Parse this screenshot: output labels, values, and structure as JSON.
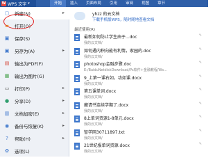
{
  "app": {
    "title": "WPS 文字",
    "logo": "W",
    "caret": "▾"
  },
  "tabs": [
    {
      "label": "开始",
      "active": true
    },
    {
      "label": "插入"
    },
    {
      "label": "页面布局"
    },
    {
      "label": "引用"
    },
    {
      "label": "审阅"
    },
    {
      "label": "视图"
    },
    {
      "label": "章节"
    }
  ],
  "menu": {
    "items": [
      {
        "label": "新建(N)",
        "icon": "new-doc-icon",
        "glyph": "▢",
        "color": "#5b8ad6",
        "arrow": "▸"
      },
      {
        "label": "打开(O)",
        "icon": "open-folder-icon",
        "glyph": "▰",
        "color": "#e6a32b",
        "arrow": ""
      },
      {
        "label": "保存(S)",
        "icon": "save-icon",
        "glyph": "▣",
        "color": "#3f78cc",
        "arrow": ""
      },
      {
        "label": "另存为(A)",
        "icon": "save-as-icon",
        "glyph": "▣",
        "color": "#3f78cc",
        "arrow": "▸"
      },
      {
        "label": "输出为PDF(F)",
        "icon": "pdf-icon",
        "glyph": "▤",
        "color": "#d64a3a",
        "arrow": ""
      },
      {
        "label": "输出为图片(G)",
        "icon": "image-icon",
        "glyph": "▦",
        "color": "#4aa34f",
        "arrow": ""
      },
      {
        "label": "打印(P)",
        "icon": "print-icon",
        "glyph": "▭",
        "color": "#555555",
        "arrow": "▸"
      },
      {
        "label": "分享(D)",
        "icon": "share-icon",
        "glyph": "●",
        "color": "#2f9e6e",
        "arrow": "▸"
      },
      {
        "label": "文档加密(E)",
        "icon": "lock-icon",
        "glyph": "▥",
        "color": "#3f78cc",
        "arrow": "▸"
      },
      {
        "label": "备份与恢复(K)",
        "icon": "backup-icon",
        "glyph": "◉",
        "color": "#3f78cc",
        "arrow": "▸"
      },
      {
        "label": "帮助(H)",
        "icon": "help-icon",
        "glyph": "?",
        "color": "#3f78cc",
        "arrow": "▸"
      },
      {
        "label": "选项(L)",
        "icon": "options-icon",
        "glyph": "✿",
        "color": "#3f78cc",
        "arrow": ""
      }
    ]
  },
  "login": {
    "user": "yhzz 的云文档",
    "link": "下载手机版WPS，随时随地查看文档"
  },
  "recent": {
    "title": "最近使用(R)",
    "items": [
      {
        "name": "最新如何防止学生由于...doc",
        "path": "我的云文档/"
      },
      {
        "name": "如何遇内积向能有利情，家园的.doc",
        "path": "我的云文档/"
      },
      {
        "name": "photoshop金融步骤.doc",
        "path": "E:/BaiduNetdiskDownload/Ps软件+金融教程/Ws..."
      },
      {
        "name": "9_上第一课右如，功如课.docx",
        "path": "我的云文档/"
      },
      {
        "name": "第五课单词.docx",
        "path": "我的云文档/"
      },
      {
        "name": "藏请书连续学期了.docx",
        "path": "我的云文档/"
      },
      {
        "name": "8上单词资源1-8单元.docx",
        "path": "我的云文档/"
      },
      {
        "name": "智学网30711897.txt",
        "path": "我的云文档/"
      },
      {
        "name": "21世纪报单词资源.docx",
        "path": "我的云文档/"
      }
    ],
    "pin": "✎"
  }
}
